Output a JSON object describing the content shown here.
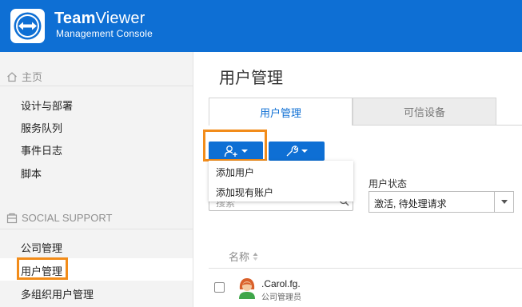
{
  "header": {
    "brand_bold": "Team",
    "brand_thin": "Viewer",
    "subtitle": "Management Console"
  },
  "sidebar": {
    "home": {
      "label": "主页",
      "items": [
        "设计与部署",
        "服务队列",
        "事件日志",
        "脚本"
      ]
    },
    "social": {
      "label": "SOCIAL SUPPORT",
      "items": [
        "公司管理",
        "用户管理",
        "多组织用户管理"
      ]
    },
    "active_item": "用户管理"
  },
  "main": {
    "title": "用户管理",
    "tabs": [
      {
        "label": "用户管理",
        "active": true
      },
      {
        "label": "可信设备",
        "active": false
      }
    ],
    "toolbar": {
      "add_user_icon": "add-user-icon",
      "settings_icon": "wrench-icon"
    },
    "dropdown": [
      "添加用户",
      "添加现有账户"
    ],
    "search_placeholder": "搜索",
    "status_filter": {
      "label": "用户状态",
      "value": "激活, 待处理请求"
    },
    "table": {
      "column": "名称",
      "rows": [
        {
          "name": ".Carol.fg.",
          "role": "公司管理员"
        }
      ]
    }
  },
  "colors": {
    "brand_blue": "#0e6fd4",
    "highlight_orange": "#f28c1a"
  }
}
